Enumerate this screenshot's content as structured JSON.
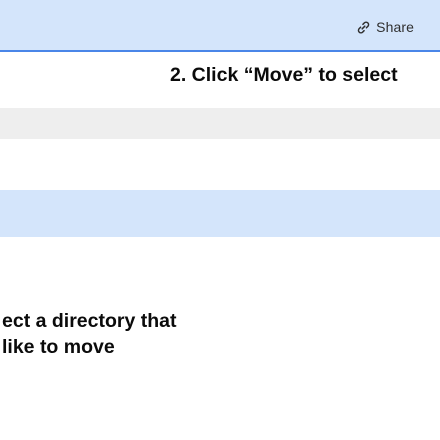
{
  "header": {
    "share_label": "Share",
    "share_icon": "link-icon",
    "background_color": "#d4e5fb",
    "border_color": "#4a86e8"
  },
  "annotations": {
    "step2": "2. Click “Move” to select",
    "step1_line1": "ect a directory that",
    "step1_line2": " like to move"
  },
  "list": {
    "highlight_color": "#d4e5fb",
    "gray_row_color": "#eeeeee"
  }
}
